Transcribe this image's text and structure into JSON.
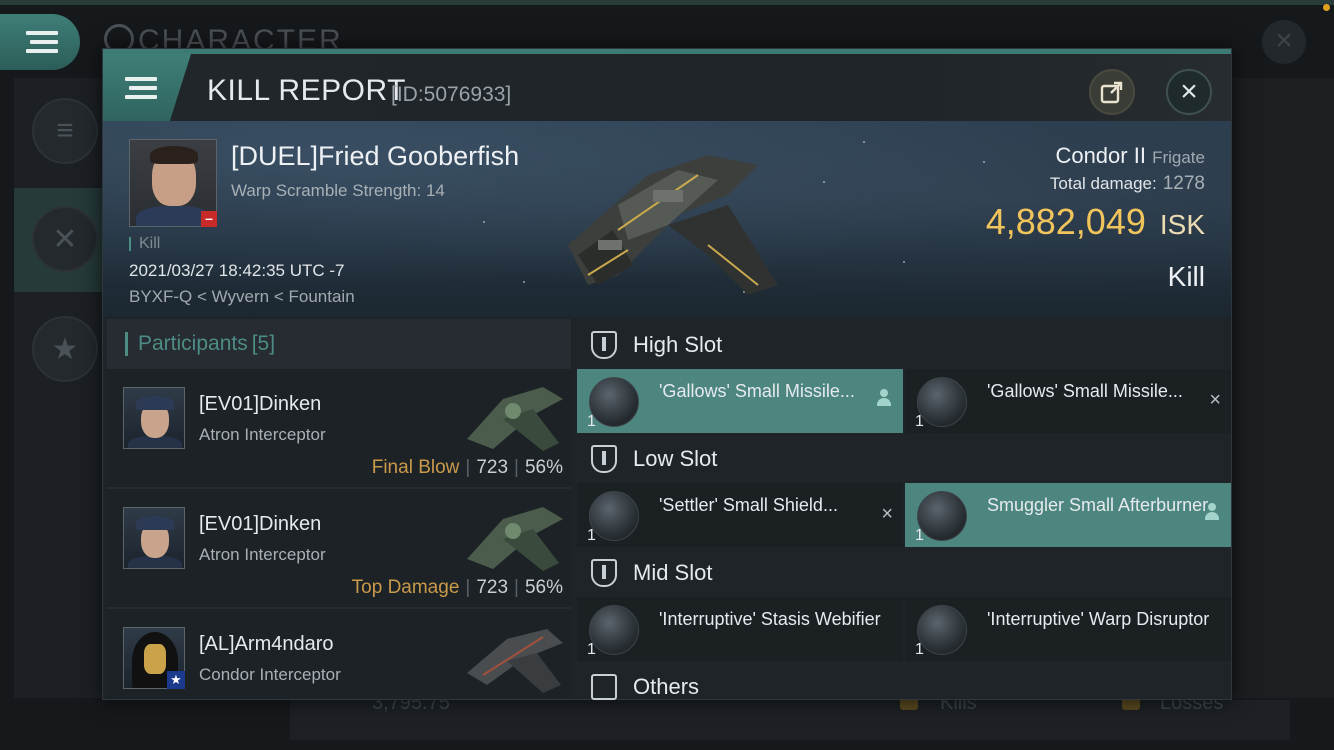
{
  "background": {
    "title": "CHARACTER",
    "bottom_value": "3,795.75",
    "bottom_kills": "Kills",
    "bottom_losses": "Losses"
  },
  "modal": {
    "title": "KILL REPORT",
    "id_label": "[ID:5076933]"
  },
  "victim": {
    "name": "[DUEL]Fried Gooberfish",
    "scramble": "Warp Scramble Strength: 14",
    "tag": "Kill",
    "datetime": "2021/03/27 18:42:35 UTC -7",
    "location": "BYXF-Q < Wyvern < Fountain",
    "ship_name": "Condor II",
    "ship_class": "Frigate",
    "total_damage_label": "Total damage:",
    "total_damage": "1278",
    "isk_value": "4,882,049",
    "isk_unit": "ISK",
    "result": "Kill"
  },
  "participants": {
    "label": "Participants",
    "count": "[5]",
    "rows": [
      {
        "name": "[EV01]Dinken",
        "ship": "Atron Interceptor",
        "badge": "Final Blow",
        "damage": "723",
        "percent": "56%",
        "sep": "|"
      },
      {
        "name": "[EV01]Dinken",
        "ship": "Atron Interceptor",
        "badge": "Top Damage",
        "damage": "723",
        "percent": "56%",
        "sep": "|"
      },
      {
        "name": "[AL]Arm4ndaro",
        "ship": "Condor Interceptor"
      }
    ]
  },
  "fitting": {
    "high": {
      "label": "High Slot",
      "items": [
        {
          "name": "'Gallows' Small Missile...",
          "qty": "1",
          "highlight": true,
          "mark": "person"
        },
        {
          "name": "'Gallows' Small Missile...",
          "qty": "1",
          "highlight": false,
          "mark": "×"
        }
      ]
    },
    "low": {
      "label": "Low Slot",
      "items": [
        {
          "name": "'Settler' Small Shield...",
          "qty": "1",
          "highlight": false,
          "mark": "×"
        },
        {
          "name": "Smuggler Small Afterburner",
          "qty": "1",
          "highlight": true,
          "mark": "person"
        }
      ]
    },
    "mid": {
      "label": "Mid Slot",
      "items": [
        {
          "name": "'Interruptive' Stasis Webifier",
          "qty": "1",
          "highlight": false
        },
        {
          "name": "'Interruptive' Warp Disruptor",
          "qty": "1",
          "highlight": false
        }
      ]
    },
    "others": {
      "label": "Others"
    }
  },
  "colors": {
    "accent": "#4d8c84",
    "isk": "#f1c55c",
    "highlight_item": "#4d867e",
    "badge_gold": "#c99a4a"
  }
}
